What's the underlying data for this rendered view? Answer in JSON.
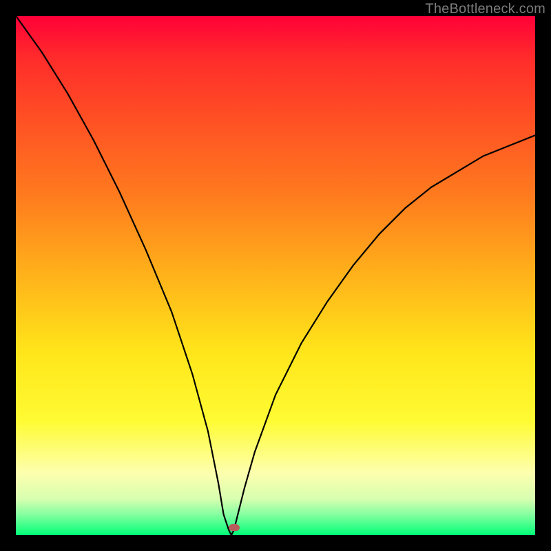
{
  "watermark": "TheBottleneck.com",
  "chart_data": {
    "type": "line",
    "title": "",
    "xlabel": "",
    "ylabel": "",
    "xlim": [
      0,
      100
    ],
    "ylim": [
      0,
      100
    ],
    "background_gradient": {
      "direction": "vertical",
      "stops": [
        {
          "pos": 0.0,
          "color": "#ff0038"
        },
        {
          "pos": 0.08,
          "color": "#ff2b2b"
        },
        {
          "pos": 0.2,
          "color": "#ff5024"
        },
        {
          "pos": 0.35,
          "color": "#ff7c1e"
        },
        {
          "pos": 0.5,
          "color": "#ffb21a"
        },
        {
          "pos": 0.65,
          "color": "#ffe61a"
        },
        {
          "pos": 0.78,
          "color": "#fffb33"
        },
        {
          "pos": 0.88,
          "color": "#fdffae"
        },
        {
          "pos": 0.93,
          "color": "#d8ffb0"
        },
        {
          "pos": 0.96,
          "color": "#86ffa0"
        },
        {
          "pos": 1.0,
          "color": "#00ff78"
        }
      ]
    },
    "series": [
      {
        "name": "bottleneck-curve",
        "x": [
          0,
          5,
          10,
          15,
          20,
          25,
          30,
          34,
          37,
          39,
          40,
          41,
          41.5,
          42,
          42.5,
          44,
          46,
          50,
          55,
          60,
          65,
          70,
          75,
          80,
          85,
          90,
          95,
          100
        ],
        "y": [
          100,
          93,
          85,
          76,
          66,
          55,
          43,
          31,
          20,
          10,
          4,
          1,
          0,
          1,
          3,
          9,
          16,
          27,
          37,
          45,
          52,
          58,
          63,
          67,
          70,
          73,
          75,
          77
        ]
      }
    ],
    "marker": {
      "x": 42,
      "y": 1.5,
      "color": "#bb5c5c"
    },
    "grid": false,
    "legend": false
  }
}
